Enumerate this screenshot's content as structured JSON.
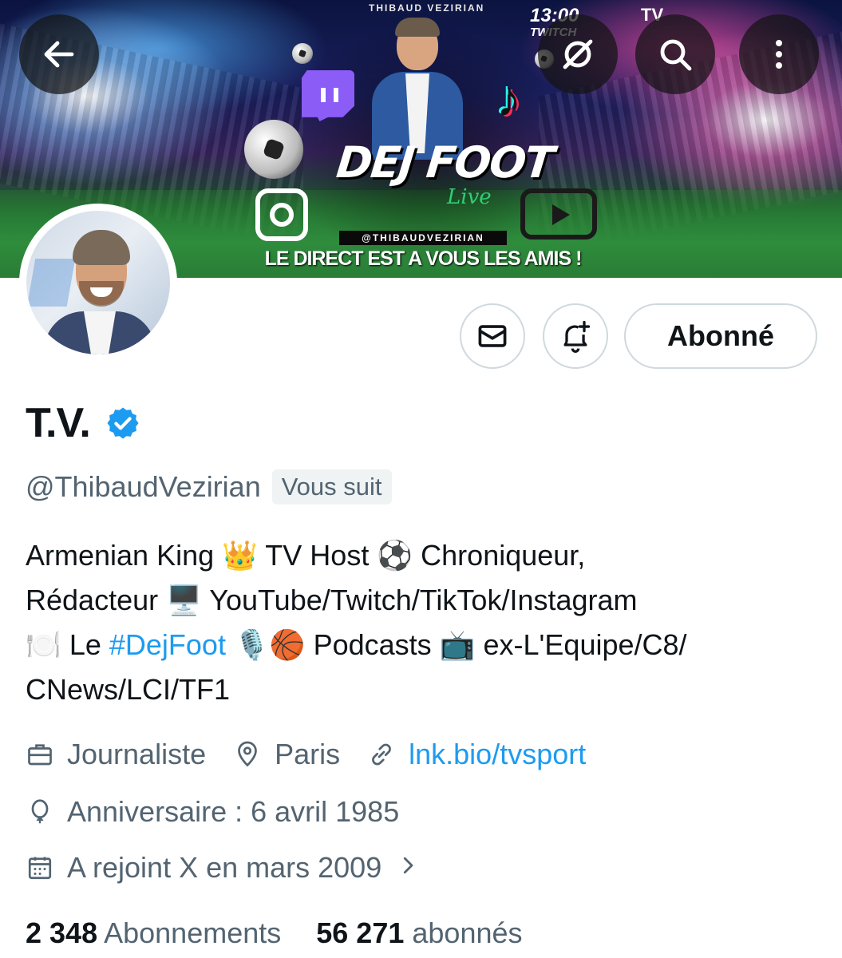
{
  "banner": {
    "top_name": "THIBAUD VEZIRIAN",
    "time": "13:00",
    "platform_word": "TWITCH",
    "corner_mark": "TV",
    "title": "DEJ FOOT",
    "title_script": "Live",
    "handle": "@THIBAUDVEZIRIAN",
    "tagline": "LE DIRECT EST A VOUS LES AMIS !"
  },
  "nav": {
    "back_icon": "arrow-left-icon",
    "grok_icon": "grok-icon",
    "search_icon": "search-icon",
    "more_icon": "more-vertical-icon"
  },
  "actions": {
    "message_icon": "envelope-icon",
    "notify_icon": "bell-plus-icon",
    "follow_label": "Abonné"
  },
  "profile": {
    "display_name": "T.V.",
    "handle": "@ThibaudVezirian",
    "follows_you": "Vous suit",
    "bio": {
      "line1": "Armenian King 👑 TV Host ⚽ Chroniqueur,",
      "line2": "Rédacteur 🖥️ YouTube/Twitch/TikTok/Instagram",
      "line3_pre": "🍽️ Le ",
      "line3_hashtag": "#DejFoot",
      "line3_post": " 🎙️🏀 Podcasts 📺 ex-L'Equipe/C8/",
      "line4": "CNews/LCI/TF1"
    },
    "profession": "Journaliste",
    "location": "Paris",
    "website": "lnk.bio/tvsport",
    "birthday": "Anniversaire : 6 avril 1985",
    "joined": "A rejoint X en mars 2009",
    "following_count": "2 348",
    "following_label": "Abonnements",
    "followers_count": "56 271",
    "followers_label": "abonnés"
  },
  "colors": {
    "link": "#1d9bf0",
    "secondary_text": "#536471",
    "primary_text": "#0f1419",
    "verified": "#1d9bf0"
  }
}
